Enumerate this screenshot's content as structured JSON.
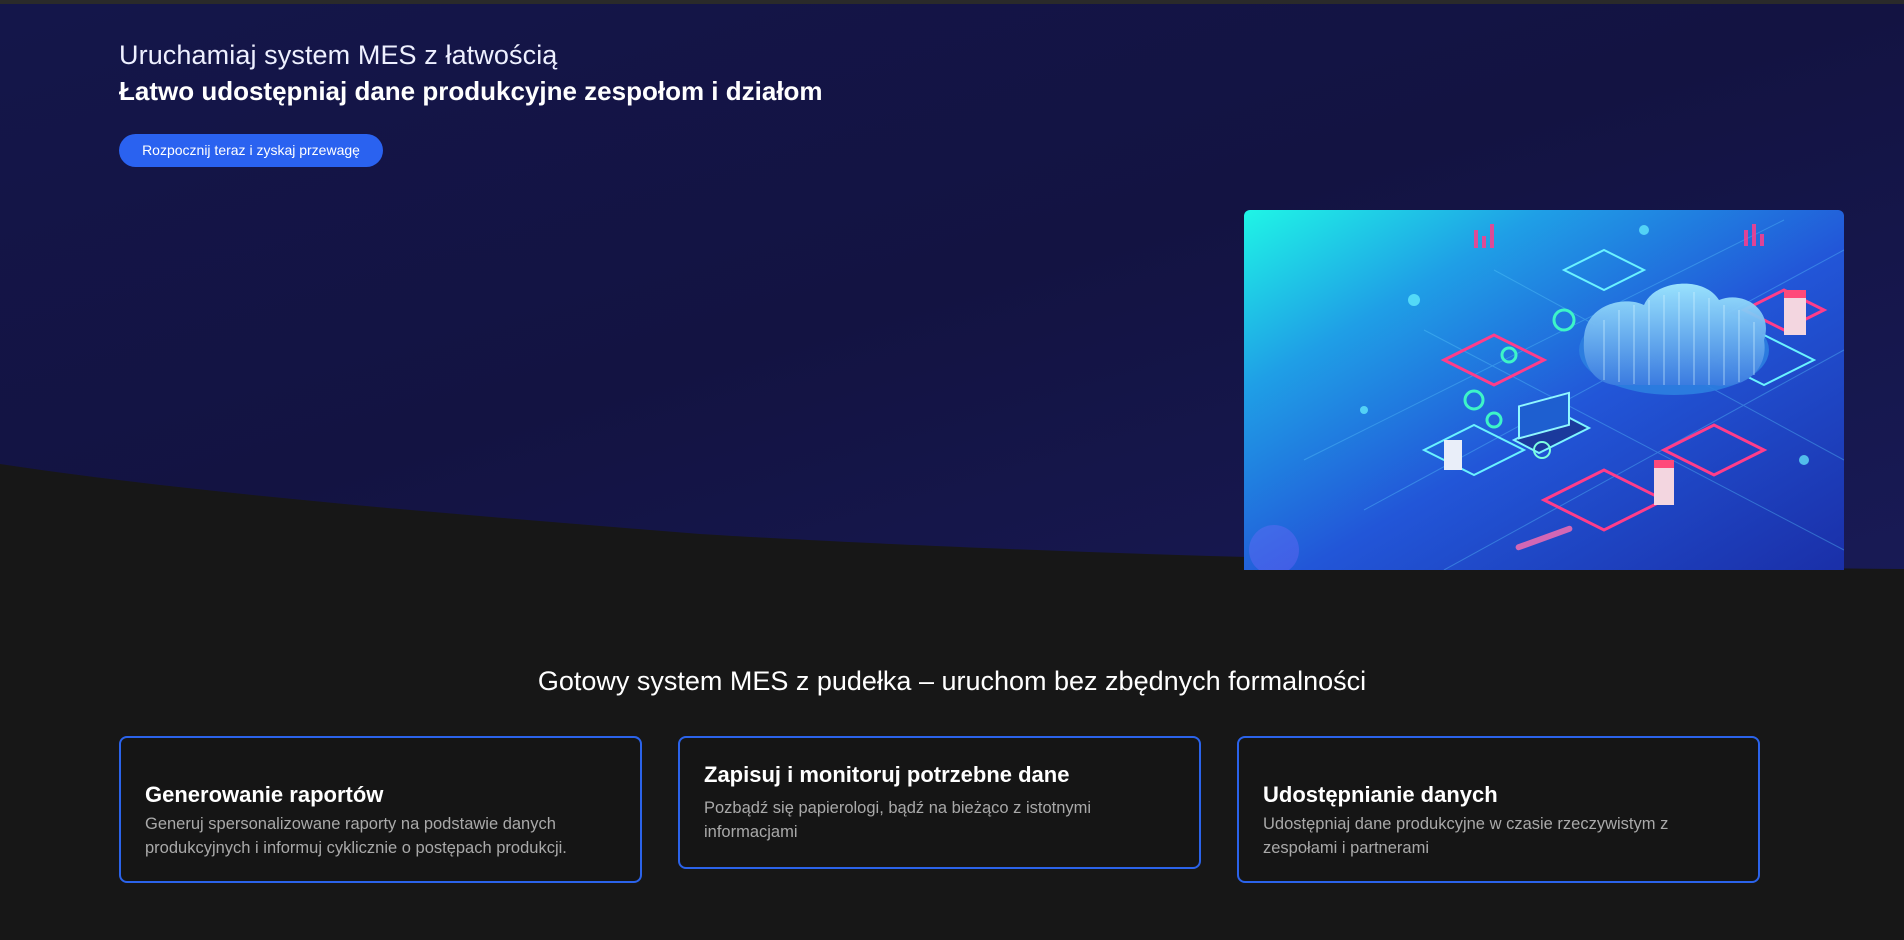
{
  "hero": {
    "title_light": "Uruchamiaj system MES z łatwością",
    "title_bold": "Łatwo udostępniaj dane produkcyjne zespołom i działom",
    "cta_label": "Rozpocznij teraz i zyskaj przewagę"
  },
  "features": {
    "title": "Gotowy system MES z pudełka – uruchom bez zbędnych formalności",
    "cards": [
      {
        "title": "Generowanie raportów",
        "description": "Generuj spersonalizowane raporty na podstawie danych produkcyjnych i informuj cyklicznie o postępach produkcji."
      },
      {
        "title": "Zapisuj i monitoruj potrzebne dane",
        "description": "Pozbądź się papierologi, bądź na bieżąco z istotnymi informacjami"
      },
      {
        "title": "Udostępnianie danych",
        "description": "Udostępniaj dane produkcyjne w czasie rzeczywistym z zespołami i partnerami"
      }
    ]
  },
  "colors": {
    "hero_background": "#141543",
    "page_background": "#171717",
    "accent": "#2a62f0",
    "card_border": "#2b63ea",
    "muted_text": "#a9a9a9"
  },
  "icons": {
    "hero_illustration": "cloud-data-illustration"
  }
}
